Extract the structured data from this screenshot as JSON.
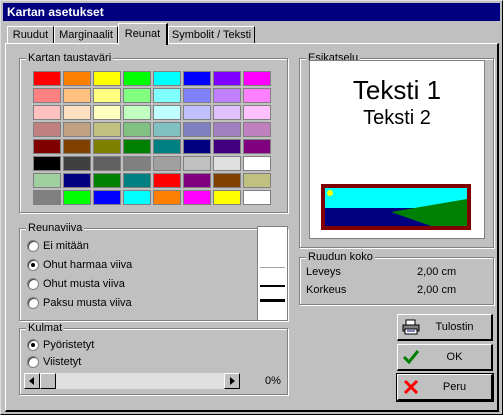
{
  "window": {
    "title": "Kartan asetukset"
  },
  "tabs": [
    {
      "label": "Ruudut",
      "active": false
    },
    {
      "label": "Marginaalit",
      "active": false
    },
    {
      "label": "Reunat",
      "active": true
    },
    {
      "label": "Symbolit / Teksti",
      "active": false
    }
  ],
  "background_group": {
    "title": "Kartan taustaväri",
    "swatches": [
      [
        "#ff0000",
        "#ff8000",
        "#ffff00",
        "#00ff00",
        "#00ffff",
        "#0000ff",
        "#8000ff",
        "#ff00ff"
      ],
      [
        "#ff8080",
        "#ffc080",
        "#ffff80",
        "#80ff80",
        "#80ffff",
        "#8080ff",
        "#c080ff",
        "#ff80ff"
      ],
      [
        "#ffc0c0",
        "#ffe0c0",
        "#ffffc0",
        "#c0ffc0",
        "#c0ffff",
        "#c0c0ff",
        "#e0c0ff",
        "#ffc0ff"
      ],
      [
        "#c08080",
        "#c0a080",
        "#c0c080",
        "#80c080",
        "#80c0c0",
        "#8080c0",
        "#a080c0",
        "#c080c0"
      ],
      [
        "#800000",
        "#804000",
        "#808000",
        "#008000",
        "#008080",
        "#000080",
        "#400080",
        "#800080"
      ],
      [
        "#000000",
        "#404040",
        "#606060",
        "#808080",
        "#a0a0a0",
        "#c0c0c0",
        "#e0e0e0",
        "#ffffff"
      ],
      [
        "#a0d0a0",
        "#000080",
        "#008000",
        "#008080",
        "#ff0000",
        "#800080",
        "#804000",
        "#c0c080"
      ],
      [
        "#808080",
        "#00ff00",
        "#0000ff",
        "#00ffff",
        "#ff8000",
        "#ff00ff",
        "#ffff00",
        "#ffffff"
      ]
    ]
  },
  "border_group": {
    "title": "Reunaviiva",
    "options": [
      {
        "label": "Ei mitään",
        "checked": false
      },
      {
        "label": "Ohut harmaa viiva",
        "checked": true
      },
      {
        "label": "Ohut musta viiva",
        "checked": false
      },
      {
        "label": "Paksu musta viiva",
        "checked": false
      }
    ]
  },
  "corners_group": {
    "title": "Kulmat",
    "options": [
      {
        "label": "Pyöristetyt",
        "checked": true
      },
      {
        "label": "Viistetyt",
        "checked": false
      }
    ],
    "slider_value": "0%"
  },
  "preview_group": {
    "title": "Esikatselu",
    "text1": "Teksti 1",
    "text2": "Teksti 2",
    "map_border_color": "#800000",
    "map_sky_color": "#00ffff",
    "map_sea_color": "#000080",
    "map_land_color": "#008000",
    "sun_color": "#ffff00"
  },
  "cell_size_group": {
    "title": "Ruudun koko",
    "rows": [
      {
        "label": "Leveys",
        "value": "2,00 cm"
      },
      {
        "label": "Korkeus",
        "value": "2,00 cm"
      }
    ]
  },
  "buttons": {
    "print": "Tulostin",
    "ok": "OK",
    "cancel": "Peru"
  },
  "icons": {
    "print": "printer-icon",
    "ok": "checkmark-icon",
    "cancel": "red-x-icon"
  }
}
